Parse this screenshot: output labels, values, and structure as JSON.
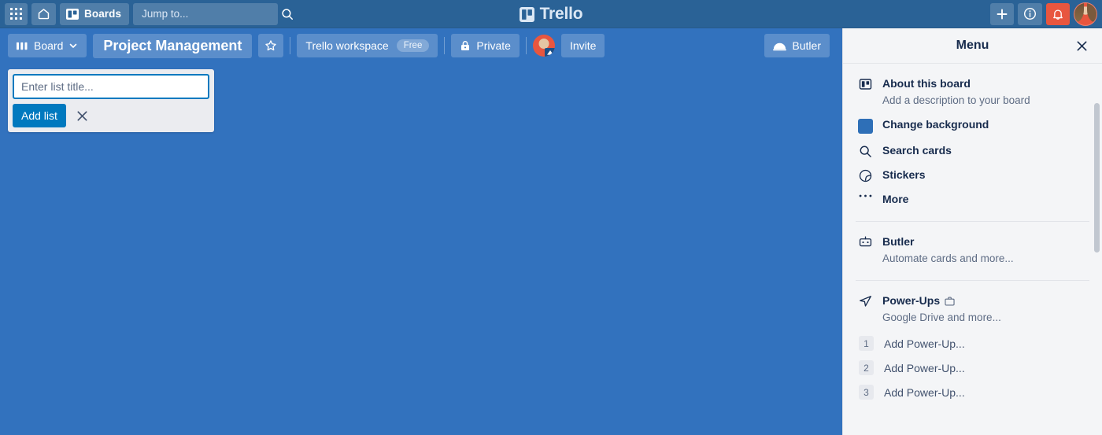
{
  "topnav": {
    "apps_icon": "grid-apps-icon",
    "home_icon": "home-icon",
    "boards_label": "Boards",
    "boards_icon": "board-icon",
    "search_placeholder": "Jump to...",
    "search_icon": "search-icon",
    "brand_name": "Trello",
    "brand_icon": "trello-logo-icon",
    "add_icon": "plus-icon",
    "info_icon": "info-circle-icon",
    "notifications_icon": "bell-icon",
    "notifications_active": true,
    "avatar": "user-avatar",
    "accent_alert": "#e8563f",
    "bg": "#2a6296"
  },
  "boardbar": {
    "view_label": "Board",
    "view_icon": "board-view-icon",
    "chevron_icon": "chevron-down-icon",
    "board_title": "Project Management",
    "star_icon": "star-icon",
    "workspace_label": "Trello workspace",
    "workspace_plan": "Free",
    "visibility_label": "Private",
    "visibility_icon": "lock-icon",
    "member_avatar": "member-avatar",
    "invite_label": "Invite",
    "butler_label": "Butler",
    "butler_icon": "butler-dome-icon",
    "bg": "#3272be"
  },
  "board": {
    "add_list": {
      "input_value": "",
      "input_placeholder": "Enter list title...",
      "submit_label": "Add list",
      "close_icon": "close-x-icon"
    }
  },
  "menu": {
    "title": "Menu",
    "close_icon": "close-x-icon",
    "items": [
      {
        "icon": "board-icon",
        "title": "About this board",
        "subtitle": "Add a description to your board"
      },
      {
        "icon": "color-swatch-icon",
        "title": "Change background",
        "subtitle": ""
      },
      {
        "icon": "search-icon",
        "title": "Search cards",
        "subtitle": ""
      },
      {
        "icon": "sticker-icon",
        "title": "Stickers",
        "subtitle": ""
      },
      {
        "icon": "ellipsis-icon",
        "title": "More",
        "subtitle": ""
      }
    ],
    "butler": {
      "icon": "robot-icon",
      "title": "Butler",
      "subtitle": "Automate cards and more..."
    },
    "powerups": {
      "icon": "rocket-icon",
      "badge_icon": "briefcase-icon",
      "title": "Power-Ups",
      "subtitle": "Google Drive and more...",
      "rows": [
        {
          "num": "1",
          "label": "Add Power-Up..."
        },
        {
          "num": "2",
          "label": "Add Power-Up..."
        },
        {
          "num": "3",
          "label": "Add Power-Up..."
        }
      ]
    },
    "bg": "#f4f5f7"
  }
}
